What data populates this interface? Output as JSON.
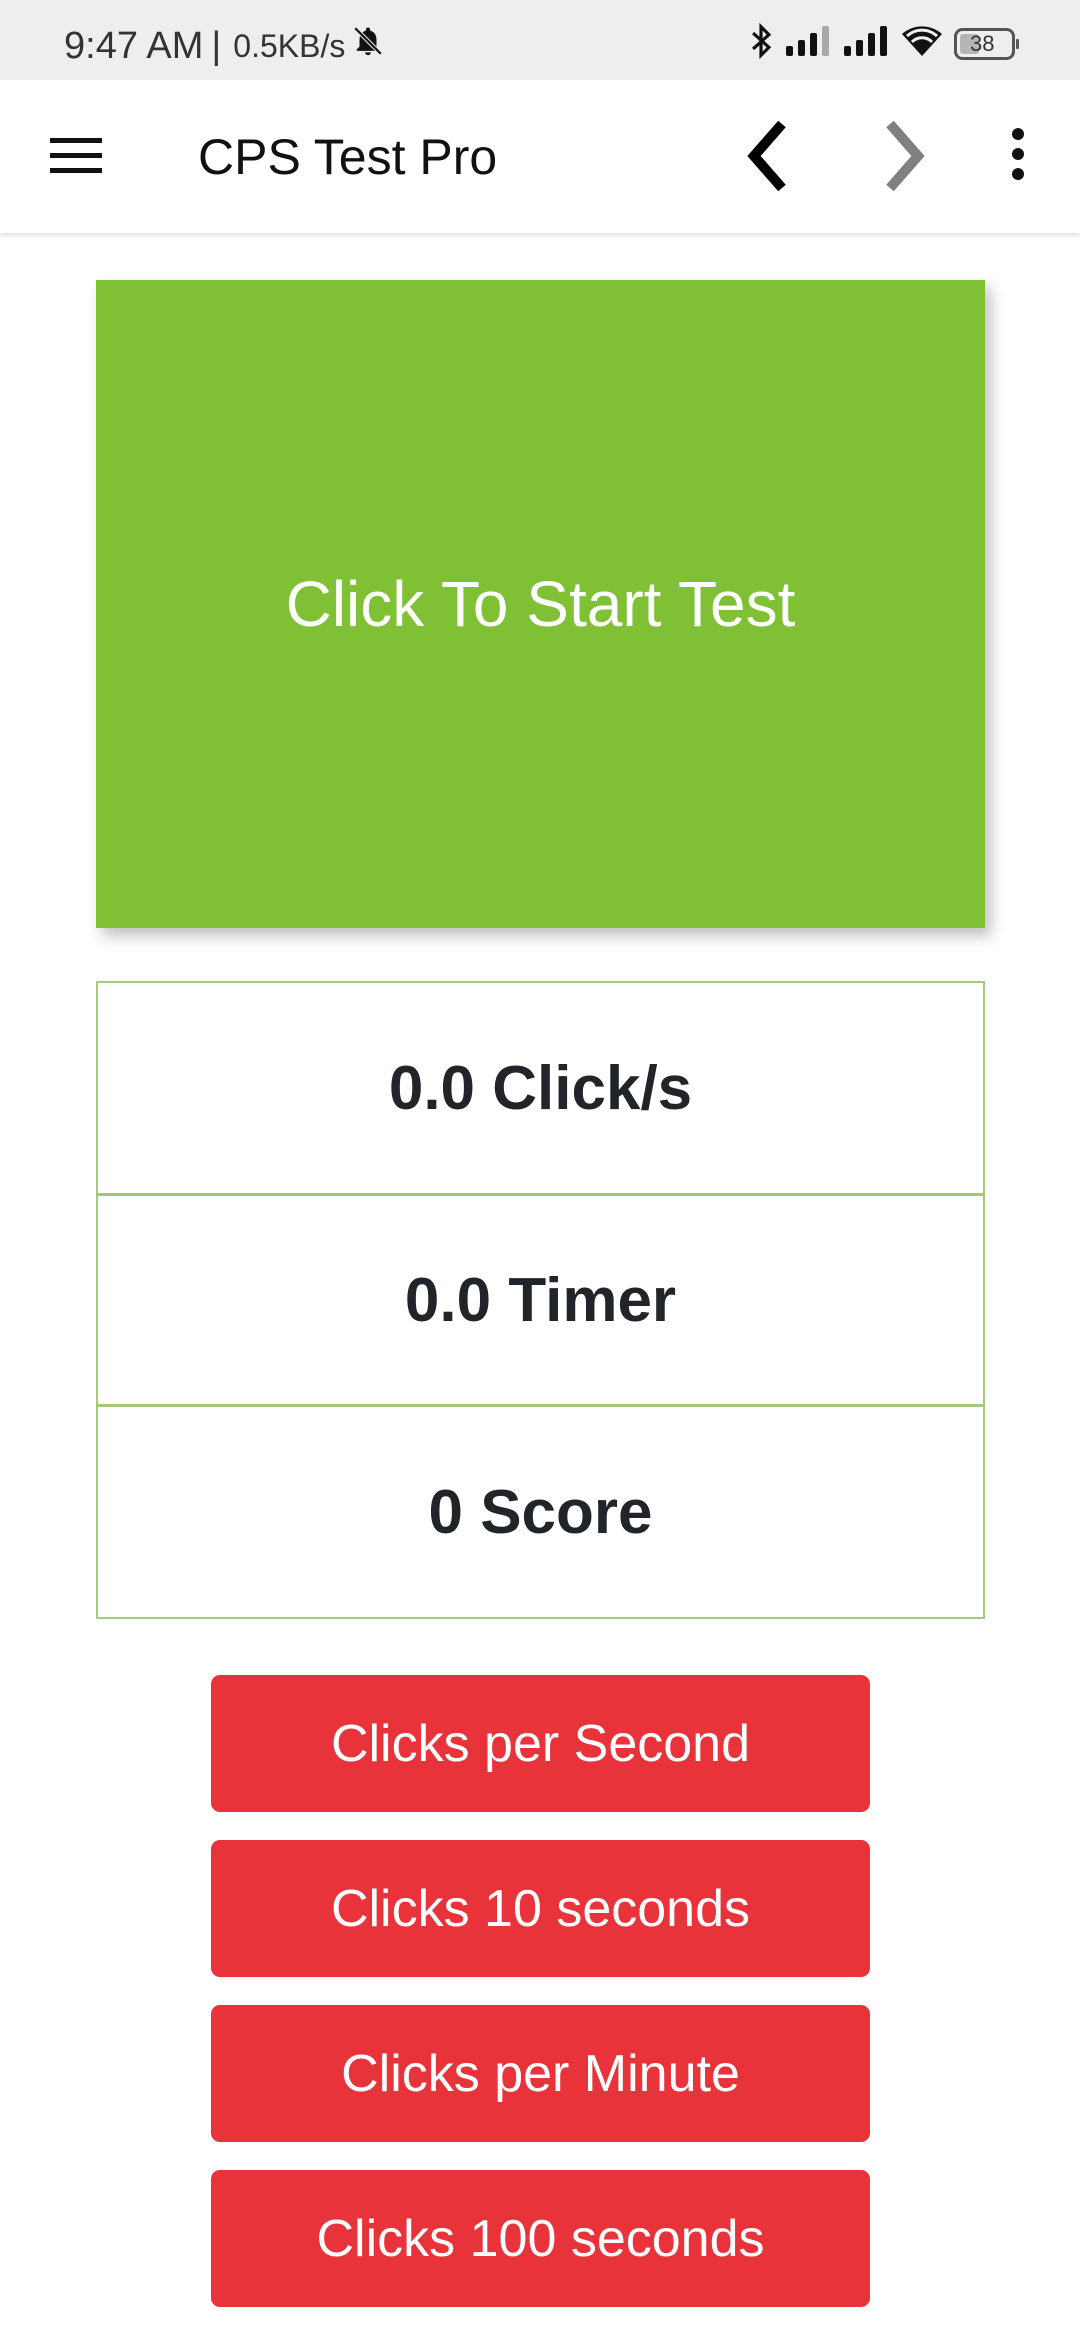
{
  "status_bar": {
    "time": "9:47 AM",
    "separator": "|",
    "network_speed": "0.5KB/s",
    "icons": [
      "bell-off-icon",
      "bluetooth-icon",
      "signal-1-icon",
      "signal-2-icon",
      "wifi-icon",
      "battery-icon"
    ],
    "battery_level": "38"
  },
  "toolbar": {
    "title": "CPS Test Pro",
    "menu_icon": "hamburger-menu-icon",
    "back_icon": "chevron-left-icon",
    "forward_icon": "chevron-right-icon",
    "more_icon": "more-vertical-icon"
  },
  "test_area": {
    "label": "Click To Start Test",
    "color": "#7fc035"
  },
  "stats": [
    {
      "value": "0.0",
      "unit": "Click/s",
      "text": "0.0 Click/s"
    },
    {
      "value": "0.0",
      "unit": "Timer",
      "text": "0.0 Timer"
    },
    {
      "value": "0",
      "unit": "Score",
      "text": "0 Score"
    }
  ],
  "modes": [
    {
      "label": "Clicks per Second"
    },
    {
      "label": "Clicks 10 seconds"
    },
    {
      "label": "Clicks per Minute"
    },
    {
      "label": "Clicks 100 seconds"
    }
  ],
  "colors": {
    "accent_green": "#7fc035",
    "border_green": "#a7c97e",
    "button_red": "#e8333b",
    "text_dark": "#212529"
  }
}
